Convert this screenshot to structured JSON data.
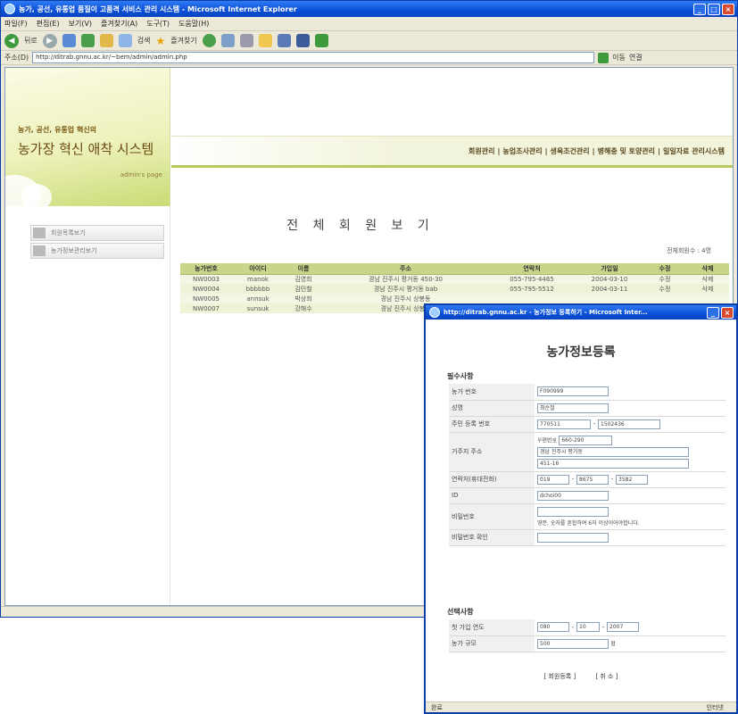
{
  "main_window": {
    "title": "농가, 공선, 유통업 품질이 고품격 서비스 관리 시스템 - Microsoft Internet Explorer",
    "menu": [
      "파일(F)",
      "편집(E)",
      "보기(V)",
      "즐겨찾기(A)",
      "도구(T)",
      "도움말(H)"
    ],
    "toolbar": {
      "back": "뒤로",
      "search": "검색",
      "favorites": "즐겨찾기"
    },
    "address_label": "주소(D)",
    "address_value": "http://ditrab.gnnu.ac.kr/~bem/admin/admin.php",
    "go_label": "이동",
    "links_label": "연결"
  },
  "logo": {
    "top": "농가, 공선, 유통업 혁신의",
    "main": "농가장 혁신 애착 시스템",
    "page": "admin's page"
  },
  "side_menu": [
    "회원목록보기",
    "농가정보관리보기"
  ],
  "nav": [
    "회원관리",
    "농업조사관리",
    "생육조건관리",
    "병해충 및 토양관리",
    "일일자료 관리시스템"
  ],
  "page_heading": "전 체 회 원 보 기",
  "count_label": "전체회원수 : 4명",
  "table": {
    "headers": [
      "농가번호",
      "아이디",
      "이름",
      "주소",
      "연락처",
      "가입일",
      "수정",
      "삭제"
    ],
    "rows": [
      [
        "NW0003",
        "manok",
        "김영희",
        "경남 진주시 평거동 450-30",
        "055-795-4465",
        "2004-03-10",
        "수정",
        "삭제"
      ],
      [
        "NW0004",
        "bbbbbb",
        "김민철",
        "경남 진주시 평거동 bab",
        "055-795-5512",
        "2004-03-11",
        "수정",
        "삭제"
      ],
      [
        "NW0005",
        "annsuk",
        "박상희",
        "경남 진주시 상봉동",
        "",
        "",
        "",
        ""
      ],
      [
        "NW0007",
        "sunsuk",
        "강해수",
        "경남 진주시 상봉동",
        "",
        "",
        "",
        ""
      ]
    ]
  },
  "popup": {
    "title": "http://ditrab.gnnu.ac.kr - 농가정보 등록하기 - Microsoft Inter...",
    "heading": "농가정보등록",
    "section_basic": "필수사항",
    "basic_fields": [
      {
        "label": "농가 번호",
        "value": "F090999"
      },
      {
        "label": "성명",
        "value": "최순철"
      },
      {
        "label": "주민 등록 번호",
        "value1": "770511",
        "value2": "1502436"
      },
      {
        "label": "거주지 주소",
        "postal_label": "우편번호",
        "postal": "660-290",
        "addr1": "경남 진주시 평거동",
        "addr2": "451-16"
      },
      {
        "label": "연락처(휴대전화)",
        "value1": "019",
        "value2": "8675",
        "value3": "3582"
      },
      {
        "label": "ID",
        "value": "dchoi00"
      },
      {
        "label": "비밀번호",
        "note": "영문, 숫자를 혼합하여 6자 이상이어야합니다."
      },
      {
        "label": "비밀번호 확인",
        "value": ""
      }
    ],
    "section_optional": "선택사항",
    "optional_fields": [
      {
        "label": "첫 가입 연도",
        "value1": "080",
        "value2": "10",
        "value3": "2007"
      },
      {
        "label": "농가 규모",
        "value": "500",
        "unit": "평"
      }
    ],
    "buttons": {
      "submit": "[ 회원등록 ]",
      "cancel": "[ 취 소 ]"
    }
  },
  "popup_status": {
    "left": "완료",
    "right": "인터넷"
  },
  "colors": {
    "title_blue": "#0a4fd6",
    "table_header": "#c9d58a",
    "nav_underline": "#b9c95e"
  }
}
